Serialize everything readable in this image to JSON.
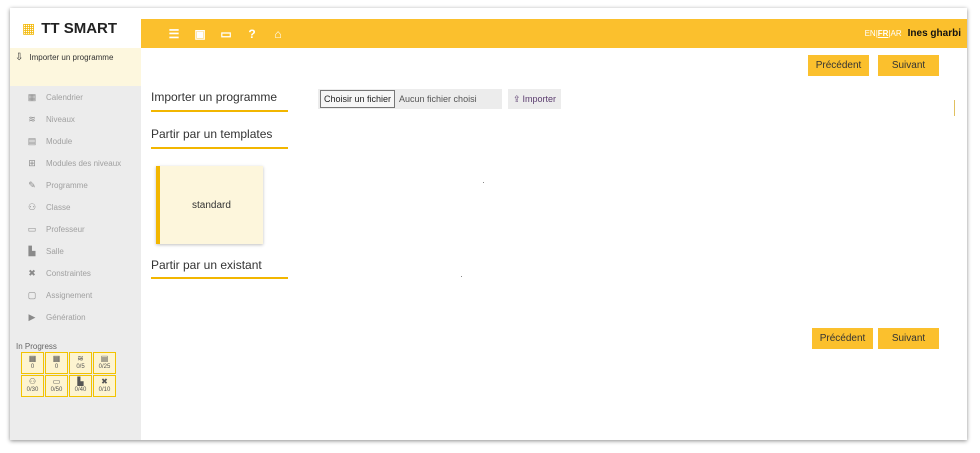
{
  "sidebar": {
    "brand": "TT SMART",
    "active_item": "Importer un programme",
    "items": [
      {
        "label": "Calendrier",
        "icon": "calendar-icon",
        "glyph": "▦"
      },
      {
        "label": "Niveaux",
        "icon": "layers-icon",
        "glyph": "≋"
      },
      {
        "label": "Module",
        "icon": "book-icon",
        "glyph": "▤"
      },
      {
        "label": "Modules des niveaux",
        "icon": "sitemap-icon",
        "glyph": "⊞"
      },
      {
        "label": "Programme",
        "icon": "pencil-icon",
        "glyph": "✎"
      },
      {
        "label": "Classe",
        "icon": "users-icon",
        "glyph": "⚇"
      },
      {
        "label": "Professeur",
        "icon": "teacher-icon",
        "glyph": "▭"
      },
      {
        "label": "Salle",
        "icon": "room-icon",
        "glyph": "▙"
      },
      {
        "label": "Constraintes",
        "icon": "tools-icon",
        "glyph": "✖"
      },
      {
        "label": "Assignement",
        "icon": "assign-icon",
        "glyph": "▢"
      },
      {
        "label": "Génération",
        "icon": "play-icon",
        "glyph": "▶"
      }
    ],
    "progress_title": "In Progress",
    "progress": [
      {
        "icon": "calendar-icon",
        "glyph": "▦",
        "value": "0"
      },
      {
        "icon": "calendar-icon",
        "glyph": "▦",
        "value": "0"
      },
      {
        "icon": "layers-icon",
        "glyph": "≋",
        "value": "0/5"
      },
      {
        "icon": "book-icon",
        "glyph": "▤",
        "value": "0/25"
      },
      {
        "icon": "users-icon",
        "glyph": "⚇",
        "value": "0/30"
      },
      {
        "icon": "teacher-icon",
        "glyph": "▭",
        "value": "0/50"
      },
      {
        "icon": "room-icon",
        "glyph": "▙",
        "value": "0/40"
      },
      {
        "icon": "tools-icon",
        "glyph": "✖",
        "value": "0/10"
      }
    ]
  },
  "topbar": {
    "icons": [
      "menu-icon",
      "save-icon",
      "teacher-icon",
      "help-icon",
      "home-icon"
    ],
    "lang_en": "EN",
    "lang_fr": "FR",
    "lang_ar": "AR",
    "sep": "|",
    "user": "Ines gharbi"
  },
  "nav": {
    "prev": "Précédent",
    "next": "Suivant"
  },
  "main": {
    "import_title": "Importer un programme",
    "choose_file": "Choisir un fichier",
    "no_file": "Aucun fichier choisi",
    "import_button": "Importer",
    "templates_title": "Partir par un templates",
    "template_card": "standard",
    "existing_title": "Partir par un existant"
  },
  "colors": {
    "accent": "#fbc02d",
    "sidebar": "#ececec"
  }
}
